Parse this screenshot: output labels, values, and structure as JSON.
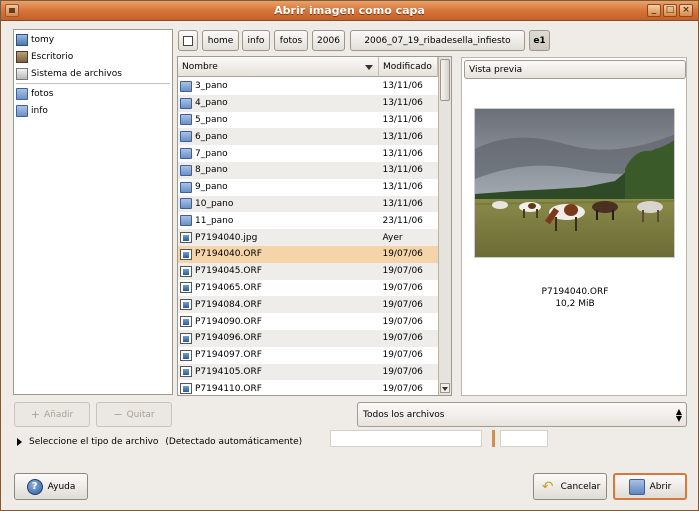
{
  "window": {
    "title": "Abrir imagen como capa"
  },
  "places": {
    "items": [
      {
        "label": "tomy",
        "icon": "home-folder-icon"
      },
      {
        "label": "Escritorio",
        "icon": "desktop-icon"
      },
      {
        "label": "Sistema de archivos",
        "icon": "filesystem-icon"
      }
    ],
    "bookmarks": [
      {
        "label": "fotos",
        "icon": "folder-icon"
      },
      {
        "label": "info",
        "icon": "folder-icon"
      }
    ]
  },
  "pathbar": {
    "segments": [
      "home",
      "info",
      "fotos",
      "2006",
      "2006_07_19_ribadesella_infiesto",
      "e1"
    ]
  },
  "filelist": {
    "columns": {
      "name": "Nombre",
      "modified": "Modificado"
    },
    "rows": [
      {
        "name": "3_pano",
        "modified": "13/11/06",
        "type": "folder"
      },
      {
        "name": "4_pano",
        "modified": "13/11/06",
        "type": "folder"
      },
      {
        "name": "5_pano",
        "modified": "13/11/06",
        "type": "folder"
      },
      {
        "name": "6_pano",
        "modified": "13/11/06",
        "type": "folder"
      },
      {
        "name": "7_pano",
        "modified": "13/11/06",
        "type": "folder"
      },
      {
        "name": "8_pano",
        "modified": "13/11/06",
        "type": "folder"
      },
      {
        "name": "9_pano",
        "modified": "13/11/06",
        "type": "folder"
      },
      {
        "name": "10_pano",
        "modified": "13/11/06",
        "type": "folder"
      },
      {
        "name": "11_pano",
        "modified": "23/11/06",
        "type": "folder"
      },
      {
        "name": "P7194040.jpg",
        "modified": "Ayer",
        "type": "image"
      },
      {
        "name": "P7194040.ORF",
        "modified": "19/07/06",
        "type": "image",
        "selected": true
      },
      {
        "name": "P7194045.ORF",
        "modified": "19/07/06",
        "type": "image"
      },
      {
        "name": "P7194065.ORF",
        "modified": "19/07/06",
        "type": "image"
      },
      {
        "name": "P7194084.ORF",
        "modified": "19/07/06",
        "type": "image"
      },
      {
        "name": "P7194090.ORF",
        "modified": "19/07/06",
        "type": "image"
      },
      {
        "name": "P7194096.ORF",
        "modified": "19/07/06",
        "type": "image"
      },
      {
        "name": "P7194097.ORF",
        "modified": "19/07/06",
        "type": "image"
      },
      {
        "name": "P7194105.ORF",
        "modified": "19/07/06",
        "type": "image"
      },
      {
        "name": "P7194110.ORF",
        "modified": "19/07/06",
        "type": "image"
      }
    ]
  },
  "preview": {
    "header": "Vista previa",
    "filename": "P7194040.ORF",
    "size": "10,2 MiB"
  },
  "actions": {
    "add_label": "Añadir",
    "remove_label": "Quitar"
  },
  "filter": {
    "selected": "Todos los archivos"
  },
  "filetype": {
    "label": "Seleccione el tipo de archivo",
    "detected": "(Detectado automáticamente)"
  },
  "buttons": {
    "help": "Ayuda",
    "cancel": "Cancelar",
    "open": "Abrir"
  },
  "colors": {
    "titlebar": "#d9753a",
    "selection": "#f4d4a8",
    "default_button_border": "#d9783e"
  }
}
